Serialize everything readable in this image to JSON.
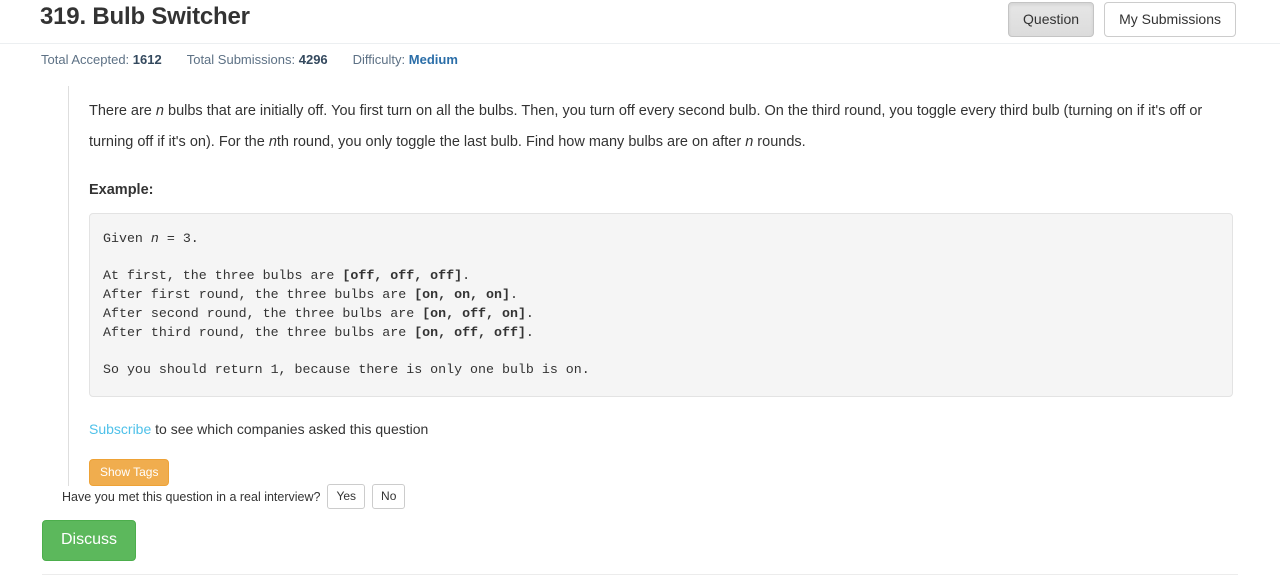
{
  "header": {
    "title": "319. Bulb Switcher",
    "buttons": [
      {
        "label": "Question",
        "active": true
      },
      {
        "label": "My Submissions",
        "active": false
      }
    ]
  },
  "stats": {
    "total_accepted_label": "Total Accepted:",
    "total_accepted_value": "1612",
    "total_submissions_label": "Total Submissions:",
    "total_submissions_value": "4296",
    "difficulty_label": "Difficulty:",
    "difficulty_value": "Medium",
    "difficulty_color": "#2b6ea8"
  },
  "description": {
    "p1_a": "There are ",
    "p1_n1": "n",
    "p1_b": " bulbs that are initially off. You first turn on all the bulbs. Then, you turn off every second bulb. On the third round, you toggle every third bulb (turning on if it's off or turning off if it's on). For the ",
    "p1_n2": "n",
    "p1_c": "th round, you only toggle the last bulb. Find how many bulbs are on after ",
    "p1_n3": "n",
    "p1_d": " rounds."
  },
  "example": {
    "label": "Example:",
    "code_lines": [
      "Given n = 3.",
      "",
      "At first, the three bulbs are [off, off, off].",
      "After first round, the three bulbs are [on, on, on].",
      "After second round, the three bulbs are [on, off, on].",
      "After third round, the three bulbs are [on, off, off].",
      "",
      "So you should return 1, because there is only one bulb is on."
    ]
  },
  "subscribe": {
    "link_text": "Subscribe",
    "rest_text": " to see which companies asked this question",
    "link_color": "#4fc1e9"
  },
  "tags": {
    "show_tags_label": "Show Tags",
    "color": "#f0ad4e"
  },
  "interview": {
    "question": "Have you met this question in a real interview?",
    "yes_label": "Yes",
    "no_label": "No"
  },
  "discuss": {
    "label": "Discuss",
    "color": "#5cb85c"
  }
}
